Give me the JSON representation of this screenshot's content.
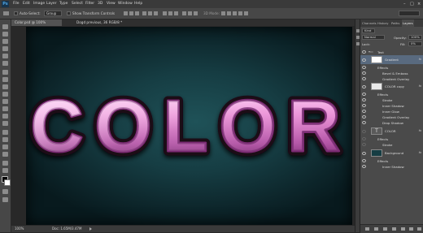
{
  "menubar": {
    "logo": "Ps",
    "items": [
      "File",
      "Edit",
      "Image",
      "Layer",
      "Type",
      "Select",
      "Filter",
      "3D",
      "View",
      "Window",
      "Help"
    ],
    "window_controls": [
      "–",
      "□",
      "×"
    ]
  },
  "options": {
    "auto_select_label": "Auto-Select:",
    "auto_select_value": "Group",
    "transform_label": "Show Transform Controls",
    "mode_3d_label": "3D Mode:"
  },
  "tabs": [
    {
      "label": "Color.psd @ 100% (Gradient...",
      "active": true
    },
    {
      "label": "Dogd previous, 36 RGB/8 *",
      "active": false
    }
  ],
  "canvas": {
    "text": "COLOR",
    "colors": {
      "text_mid": "#d86fc2",
      "text_dark": "#6a1a62",
      "text_light": "#ffd2f6",
      "outline": "#1a0716",
      "bg": "#173f45"
    }
  },
  "status": {
    "zoom": "100%",
    "doc": "Doc: 1.65M/3.47M"
  },
  "panel": {
    "tabs": [
      "Channels",
      "History",
      "Paths",
      "Layers"
    ],
    "active_tab": "Layers",
    "kind_label": "Kind",
    "blend_mode": "Normal",
    "opacity_label": "Opacity:",
    "opacity_value": "100%",
    "lock_label": "Lock:",
    "fill_label": "Fill:",
    "fill_value": "0%",
    "layers": [
      {
        "name": "Text",
        "type": "group"
      },
      {
        "name": "Gradient",
        "type": "layer",
        "fx": "fx",
        "selected": true
      },
      {
        "name": "Effects",
        "type": "effects"
      },
      {
        "name": "Bevel & Emboss",
        "type": "effect"
      },
      {
        "name": "Gradient Overlay",
        "type": "effect"
      },
      {
        "name": "COLOR copy",
        "type": "layer",
        "fx": "fx"
      },
      {
        "name": "Effects",
        "type": "effects"
      },
      {
        "name": "Stroke",
        "type": "effect"
      },
      {
        "name": "Inner Shadow",
        "type": "effect"
      },
      {
        "name": "Inner Glow",
        "type": "effect"
      },
      {
        "name": "Gradient Overlay",
        "type": "effect"
      },
      {
        "name": "Drop Shadow",
        "type": "effect"
      },
      {
        "name": "COLOR",
        "type": "textlayer",
        "fx": "fx"
      },
      {
        "name": "Effects",
        "type": "effects"
      },
      {
        "name": "Stroke",
        "type": "effect"
      },
      {
        "name": "Background",
        "type": "layer",
        "fx": "fx"
      },
      {
        "name": "Effects",
        "type": "effects"
      },
      {
        "name": "Inner Shadow",
        "type": "effect"
      }
    ]
  }
}
